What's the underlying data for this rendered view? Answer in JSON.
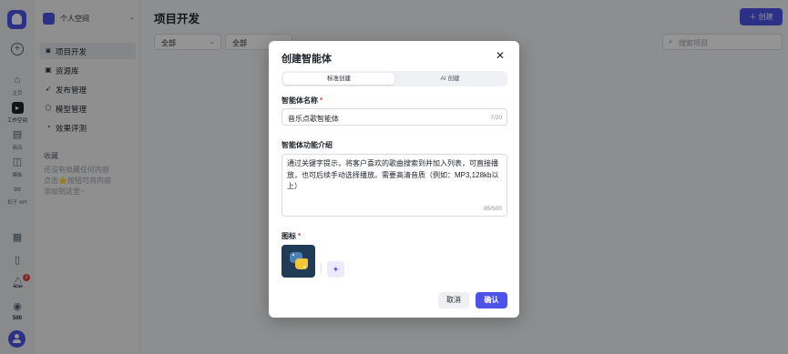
{
  "rail": {
    "items": [
      {
        "label": "主页",
        "icon": "home-icon"
      },
      {
        "label": "工作空间",
        "icon": "terminal-icon"
      },
      {
        "label": "商店",
        "icon": "store-icon"
      },
      {
        "label": "模板",
        "icon": "template-icon"
      },
      {
        "label": "扣子 API",
        "icon": "link-icon"
      }
    ],
    "notification_count": "2",
    "points": "500"
  },
  "sidebar": {
    "space_name": "个人空间",
    "items": [
      {
        "label": "项目开发",
        "icon": "chat-bubble-icon"
      },
      {
        "label": "资源库",
        "icon": "library-icon"
      },
      {
        "label": "发布管理",
        "icon": "rocket-icon"
      },
      {
        "label": "模型管理",
        "icon": "cube-icon"
      },
      {
        "label": "效果评测",
        "icon": "gauge-icon"
      }
    ],
    "favorites_title": "收藏",
    "favorites_empty": "还没有收藏任何内容 点击⭐按钮可将内容添加到这里~"
  },
  "main": {
    "title": "项目开发",
    "create_label": "创建",
    "filter1": "全部",
    "filter2": "全部",
    "search_placeholder": "搜索项目"
  },
  "modal": {
    "title": "创建智能体",
    "tabs": [
      "标准创建",
      "AI 创建"
    ],
    "name_label": "智能体名称",
    "name_value": "音乐点歌智能体",
    "name_count": "7/20",
    "desc_label": "智能体功能介绍",
    "desc_value": "通过关键字提示，将客户喜欢的歌曲搜索到并加入列表，可直接播放，也可后续手动选择播放。需要高清音质（例如：MP3,128kb以上）",
    "desc_count": "65/500",
    "icon_label": "图标",
    "cancel_label": "取消",
    "confirm_label": "确认"
  },
  "colors": {
    "accent": "#4d53e8",
    "required": "#e0413f"
  }
}
